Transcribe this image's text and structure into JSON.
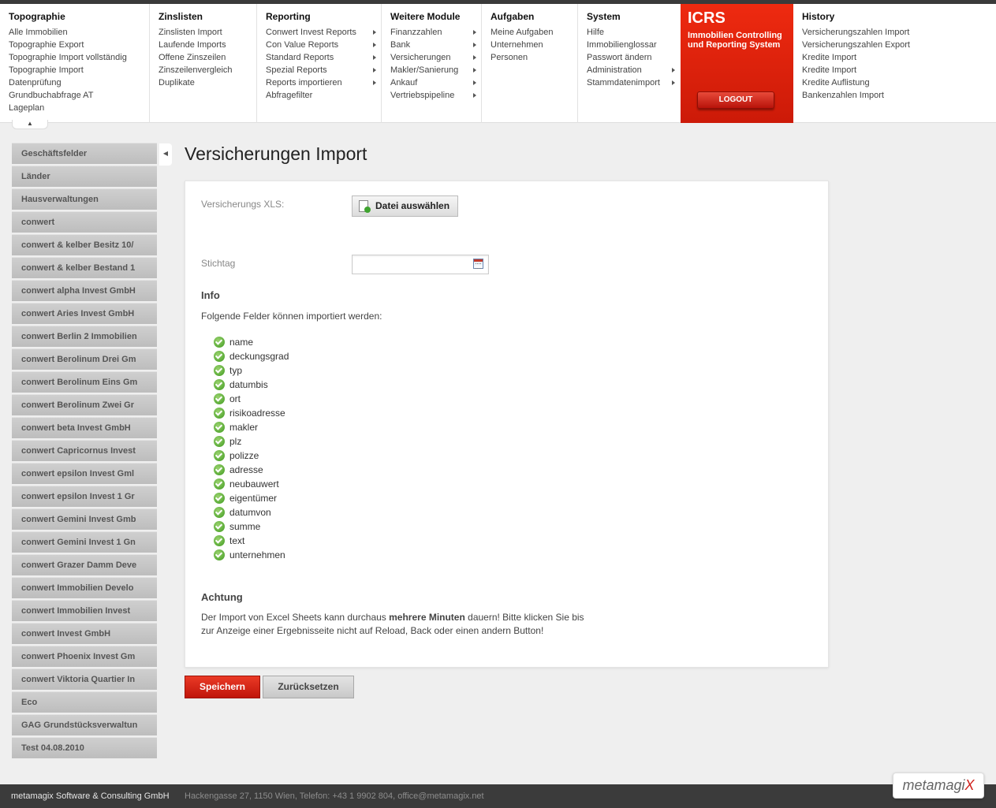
{
  "menu": {
    "columns": [
      {
        "title": "Topographie",
        "items": [
          {
            "label": "Alle Immobilien",
            "sub": false
          },
          {
            "label": "Topographie Export",
            "sub": false
          },
          {
            "label": "Topographie Import vollständig",
            "sub": false
          },
          {
            "label": "Topographie Import",
            "sub": false
          },
          {
            "label": "Datenprüfung",
            "sub": false
          },
          {
            "label": "Grundbuchabfrage AT",
            "sub": false
          },
          {
            "label": "Lageplan",
            "sub": false
          }
        ]
      },
      {
        "title": "Zinslisten",
        "items": [
          {
            "label": "Zinslisten Import",
            "sub": false
          },
          {
            "label": "Laufende Imports",
            "sub": false
          },
          {
            "label": "Offene Zinszeilen",
            "sub": false
          },
          {
            "label": "Zinszeilenvergleich",
            "sub": false
          },
          {
            "label": "Duplikate",
            "sub": false
          }
        ]
      },
      {
        "title": "Reporting",
        "items": [
          {
            "label": "Conwert Invest Reports",
            "sub": true
          },
          {
            "label": "Con Value Reports",
            "sub": true
          },
          {
            "label": "Standard Reports",
            "sub": true
          },
          {
            "label": "Spezial Reports",
            "sub": true
          },
          {
            "label": "Reports importieren",
            "sub": true
          },
          {
            "label": "Abfragefilter",
            "sub": false
          }
        ]
      },
      {
        "title": "Weitere Module",
        "items": [
          {
            "label": "Finanzzahlen",
            "sub": true
          },
          {
            "label": "Bank",
            "sub": true
          },
          {
            "label": "Versicherungen",
            "sub": true
          },
          {
            "label": "Makler/Sanierung",
            "sub": true
          },
          {
            "label": "Ankauf",
            "sub": true
          },
          {
            "label": "Vertriebspipeline",
            "sub": true
          }
        ]
      },
      {
        "title": "Aufgaben",
        "items": [
          {
            "label": "Meine Aufgaben",
            "sub": false
          },
          {
            "label": "Unternehmen",
            "sub": false
          },
          {
            "label": "Personen",
            "sub": false
          }
        ]
      },
      {
        "title": "System",
        "items": [
          {
            "label": "Hilfe",
            "sub": false
          },
          {
            "label": "Immobilienglossar",
            "sub": false
          },
          {
            "label": "Passwort ändern",
            "sub": false
          },
          {
            "label": "Administration",
            "sub": true
          },
          {
            "label": "Stammdatenimport",
            "sub": true
          }
        ]
      },
      {
        "title": "History",
        "items": [
          {
            "label": "Versicherungszahlen Import",
            "sub": false
          },
          {
            "label": "Versicherungszahlen Export",
            "sub": false
          },
          {
            "label": "Kredite Import",
            "sub": false
          },
          {
            "label": "Kredite Import",
            "sub": false
          },
          {
            "label": "Kredite Auflistung",
            "sub": false
          },
          {
            "label": "Bankenzahlen Import",
            "sub": false
          }
        ]
      }
    ],
    "brand": {
      "logo": "ICRS",
      "subtitle": "Immobilien Controlling und Reporting System",
      "logout_label": "LOGOUT"
    }
  },
  "sidebar": {
    "items": [
      "Geschäftsfelder",
      "Länder",
      "Hausverwaltungen",
      "conwert",
      "conwert & kelber Besitz 10/",
      "conwert & kelber Bestand 1",
      "conwert alpha Invest GmbH",
      "conwert Aries Invest GmbH",
      "conwert Berlin 2 Immobilien",
      "conwert Berolinum Drei Gm",
      "conwert Berolinum Eins Gm",
      "conwert Berolinum Zwei Gr",
      "conwert beta Invest GmbH",
      "conwert Capricornus Invest",
      "conwert epsilon Invest Gml",
      "conwert epsilon Invest 1 Gr",
      "conwert Gemini Invest Gmb",
      "conwert Gemini Invest 1 Gn",
      "conwert Grazer Damm Deve",
      "conwert Immobilien Develo",
      "conwert Immobilien Invest",
      "conwert Invest GmbH",
      "conwert Phoenix Invest Gm",
      "conwert Viktoria Quartier In",
      "Eco",
      "GAG Grundstücksverwaltun",
      "Test 04.08.2010"
    ]
  },
  "main": {
    "title": "Versicherungen Import",
    "xls_label": "Versicherungs XLS:",
    "file_button": "Datei auswählen",
    "date_label": "Stichtag",
    "date_value": "",
    "info_heading": "Info",
    "info_text": "Folgende Felder können importiert werden:",
    "fields": [
      "name",
      "deckungsgrad",
      "typ",
      "datumbis",
      "ort",
      "risikoadresse",
      "makler",
      "plz",
      "polizze",
      "adresse",
      "neubauwert",
      "eigentümer",
      "datumvon",
      "summe",
      "text",
      "unternehmen"
    ],
    "warning_heading": "Achtung",
    "warning_pre": "Der Import von Excel Sheets kann durchaus ",
    "warning_bold": "mehrere Minuten",
    "warning_post": " dauern! Bitte klicken Sie bis",
    "warning_line2": "zur Anzeige einer Ergebnisseite nicht auf Reload, Back oder einen andern Button!",
    "save_label": "Speichern",
    "reset_label": "Zurücksetzen"
  },
  "footer": {
    "company": "metamagix Software & Consulting GmbH",
    "address": "Hackengasse 27, 1150 Wien, Telefon: +43 1 9902 804, office@metamagix.net",
    "logo_text": "metamagi",
    "logo_x": "X"
  },
  "colors": {
    "accent": "#e8200b",
    "sidebar": "#c6c6c6",
    "footer": "#3b3b3b"
  }
}
